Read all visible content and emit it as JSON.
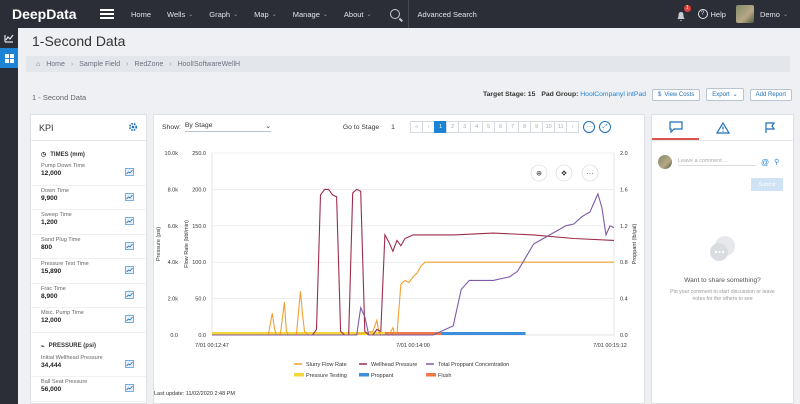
{
  "nav": {
    "brand": "DeepData",
    "items": [
      {
        "label": "Home",
        "caret": false
      },
      {
        "label": "Wells",
        "caret": true
      },
      {
        "label": "Graph",
        "caret": true
      },
      {
        "label": "Map",
        "caret": true
      },
      {
        "label": "Manage",
        "caret": true
      },
      {
        "label": "About",
        "caret": true
      }
    ],
    "advanced_search": "Advanced Search",
    "notification_count": "1",
    "help": "Help",
    "user": "Demo"
  },
  "page": {
    "title": "1-Second Data",
    "breadcrumbs": [
      "Home",
      "Sample Field",
      "RedZone",
      "HoolISoftwareWellH"
    ],
    "subtitle": "1 - Second Data",
    "target_stage_label": "Target Stage:",
    "target_stage": "15",
    "pad_group_label": "Pad Group:",
    "pad_group": "HoolCompanyl intPad",
    "view_costs": "View Costs",
    "export": "Export",
    "add_report": "Add Report"
  },
  "kpi": {
    "title": "KPI",
    "sections": [
      {
        "title": "TIMES (mm)",
        "icon": "clock-icon",
        "items": [
          {
            "label": "Pump Down Time",
            "value": "12,000"
          },
          {
            "label": "Down Time",
            "value": "9,900"
          },
          {
            "label": "Sweep Time",
            "value": "1,200"
          },
          {
            "label": "Sand Plug Time",
            "value": "800"
          },
          {
            "label": "Pressure Test Time",
            "value": "15,890"
          },
          {
            "label": "Frac Time",
            "value": "8,900"
          },
          {
            "label": "Misc. Pump Time",
            "value": "12,000"
          }
        ]
      },
      {
        "title": "PRESSURE (psi)",
        "icon": "gauge-icon",
        "items": [
          {
            "label": "Initial Wellhead Pressure",
            "value": "34,444"
          },
          {
            "label": "Ball Seat Pressure",
            "value": "56,000"
          }
        ]
      }
    ]
  },
  "controls": {
    "show_label": "Show:",
    "show_value": "By Stage",
    "goto_label": "Go to Stage",
    "goto_value": "1",
    "pages": [
      "1",
      "2",
      "3",
      "4",
      "5",
      "6",
      "7",
      "8",
      "9",
      "10",
      "11"
    ],
    "active_page": "1",
    "last_update": "Last update: 11/02/2020 2:48 PM"
  },
  "chart_data": {
    "type": "line",
    "x_start": "7/01 00:12:47",
    "x_mid": "7/01 00:14:00",
    "x_end": "7/01 00:15:12",
    "axes": {
      "pressure": {
        "label": "Pressure (psi)",
        "ticks": [
          "0.0",
          "2.0k",
          "4.0k",
          "6.0k",
          "8.0k",
          "10.0k"
        ],
        "range": [
          0,
          10000
        ]
      },
      "flow_rate": {
        "label": "Flow Rate (bbl/min)",
        "ticks": [
          "0.0",
          "50.0",
          "100.0",
          "150.0",
          "200.0",
          "250.0"
        ],
        "range": [
          0,
          250
        ]
      },
      "proppant": {
        "label": "Proppant (lb/gal)",
        "ticks": [
          "0.0",
          "0.4",
          "0.8",
          "1.2",
          "1.6",
          "2.0"
        ],
        "range": [
          0,
          2.0
        ]
      }
    },
    "series": [
      {
        "name": "Slurry Flow Rate",
        "color": "#f0a030",
        "axis": "flow_rate",
        "points": [
          [
            0.0,
            0
          ],
          [
            0.1,
            0
          ],
          [
            0.14,
            0
          ],
          [
            0.15,
            30
          ],
          [
            0.155,
            10
          ],
          [
            0.16,
            0
          ],
          [
            0.17,
            0
          ],
          [
            0.18,
            45
          ],
          [
            0.185,
            5
          ],
          [
            0.19,
            0
          ],
          [
            0.2,
            0
          ],
          [
            0.21,
            0
          ],
          [
            0.22,
            60
          ],
          [
            0.225,
            30
          ],
          [
            0.23,
            5
          ],
          [
            0.24,
            0
          ],
          [
            0.28,
            0
          ],
          [
            0.35,
            0
          ],
          [
            0.4,
            5
          ],
          [
            0.41,
            20
          ],
          [
            0.415,
            5
          ],
          [
            0.42,
            0
          ],
          [
            0.44,
            0
          ],
          [
            0.45,
            10
          ],
          [
            0.455,
            0
          ],
          [
            0.46,
            0
          ],
          [
            0.47,
            70
          ],
          [
            0.48,
            75
          ],
          [
            0.49,
            72
          ],
          [
            0.5,
            80
          ],
          [
            0.51,
            85
          ],
          [
            0.52,
            95
          ],
          [
            0.53,
            100
          ],
          [
            0.7,
            100
          ],
          [
            1.0,
            100
          ]
        ]
      },
      {
        "name": "Wellhead Pressure",
        "color": "#9b2d4a",
        "axis": "pressure",
        "points": [
          [
            0.0,
            0
          ],
          [
            0.1,
            0
          ],
          [
            0.2,
            0
          ],
          [
            0.25,
            0
          ],
          [
            0.26,
            300
          ],
          [
            0.27,
            7700
          ],
          [
            0.28,
            8000
          ],
          [
            0.29,
            8000
          ],
          [
            0.3,
            7700
          ],
          [
            0.31,
            7600
          ],
          [
            0.32,
            200
          ],
          [
            0.33,
            0
          ],
          [
            0.34,
            0
          ],
          [
            0.35,
            7800
          ],
          [
            0.36,
            8000
          ],
          [
            0.37,
            7900
          ],
          [
            0.38,
            200
          ],
          [
            0.39,
            0
          ],
          [
            0.4,
            0
          ],
          [
            0.41,
            300
          ],
          [
            0.42,
            200
          ],
          [
            0.43,
            5500
          ],
          [
            0.44,
            5100
          ],
          [
            0.45,
            4600
          ],
          [
            0.46,
            5200
          ],
          [
            0.47,
            4900
          ],
          [
            0.48,
            5300
          ],
          [
            0.49,
            5400
          ],
          [
            0.5,
            5500
          ],
          [
            0.6,
            5500
          ],
          [
            0.7,
            5600
          ],
          [
            0.8,
            5500
          ],
          [
            0.9,
            5300
          ],
          [
            1.0,
            5200
          ]
        ]
      },
      {
        "name": "Total Proppant Concentration",
        "color": "#7c5aa6",
        "axis": "proppant",
        "points": [
          [
            0.0,
            0
          ],
          [
            0.3,
            0
          ],
          [
            0.36,
            0
          ],
          [
            0.37,
            0.3
          ],
          [
            0.38,
            0.2
          ],
          [
            0.39,
            0
          ],
          [
            0.4,
            0
          ],
          [
            0.5,
            0
          ],
          [
            0.55,
            0
          ],
          [
            0.6,
            0.1
          ],
          [
            0.62,
            0.5
          ],
          [
            0.64,
            0.6
          ],
          [
            0.66,
            0.6
          ],
          [
            0.68,
            0.6
          ],
          [
            0.7,
            0.6
          ],
          [
            0.72,
            0.62
          ],
          [
            0.74,
            0.64
          ],
          [
            0.76,
            0.7
          ],
          [
            0.78,
            0.85
          ],
          [
            0.8,
            1.0
          ],
          [
            0.82,
            1.05
          ],
          [
            0.84,
            1.1
          ],
          [
            0.86,
            1.15
          ],
          [
            0.88,
            1.2
          ],
          [
            0.9,
            1.22
          ],
          [
            0.92,
            1.3
          ],
          [
            0.94,
            1.35
          ],
          [
            0.96,
            1.55
          ],
          [
            0.97,
            1.4
          ],
          [
            0.98,
            1.1
          ],
          [
            0.99,
            1.2
          ],
          [
            1.0,
            1.18
          ]
        ]
      }
    ],
    "stage_bands": [
      {
        "name": "Pressure Testing",
        "color": "#f5d53a",
        "from": 0.0,
        "to": 0.43
      },
      {
        "name": "Pad/Flush",
        "color": "#f07a45",
        "from": 0.43,
        "to": 0.57
      },
      {
        "name": "Proppant",
        "color": "#3d8fdb",
        "from": 0.57,
        "to": 0.78
      }
    ],
    "legend": [
      {
        "name": "Slurry Flow Rate",
        "color": "#f0a030",
        "kind": "line"
      },
      {
        "name": "Wellhead Pressure",
        "color": "#9b2d4a",
        "kind": "line"
      },
      {
        "name": "Total Proppant Concentration",
        "color": "#7c5aa6",
        "kind": "line"
      },
      {
        "name": "Pressure Testing",
        "color": "#f5d53a",
        "kind": "bar"
      },
      {
        "name": "Proppant",
        "color": "#3d8fdb",
        "kind": "bar"
      },
      {
        "name": "Flush",
        "color": "#f07a45",
        "kind": "bar"
      }
    ]
  },
  "comments": {
    "placeholder": "Leave a comment ...",
    "submit": "Submit",
    "empty_title": "Want to share something?",
    "empty_sub": "Pin your comment to start discussion or leave notes for the others to see"
  },
  "colors": {
    "accent": "#1d83d4",
    "nav_bg": "#2b2e36",
    "alert": "#d9534f"
  }
}
